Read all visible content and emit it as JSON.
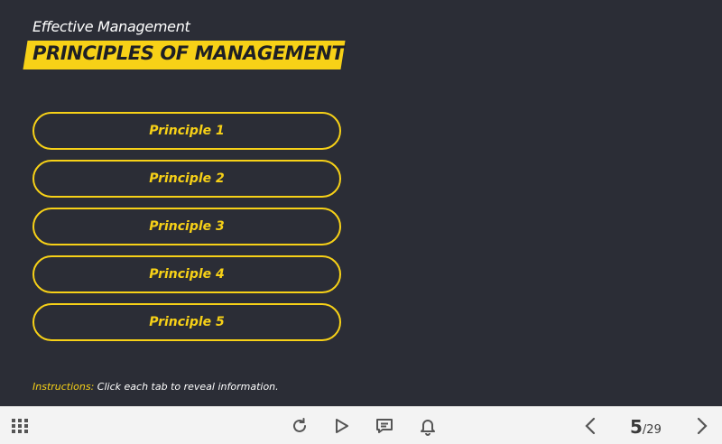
{
  "header": {
    "subtitle": "Effective Management",
    "title": "PRINCIPLES OF MANAGEMENT"
  },
  "tabs": [
    {
      "label": "Principle 1"
    },
    {
      "label": "Principle 2"
    },
    {
      "label": "Principle 3"
    },
    {
      "label": "Principle 4"
    },
    {
      "label": "Principle 5"
    }
  ],
  "instructions": {
    "label": "Instructions:",
    "text": " Click each tab to reveal information."
  },
  "toolbar": {
    "icons": [
      "grid-menu-icon",
      "replay-icon",
      "play-icon",
      "comment-icon",
      "bell-icon",
      "previous-icon",
      "next-icon"
    ],
    "current_page": "5",
    "total_pages": "/29"
  },
  "colors": {
    "background": "#2b2d36",
    "accent": "#f7d117",
    "toolbar": "#f3f3f3"
  }
}
